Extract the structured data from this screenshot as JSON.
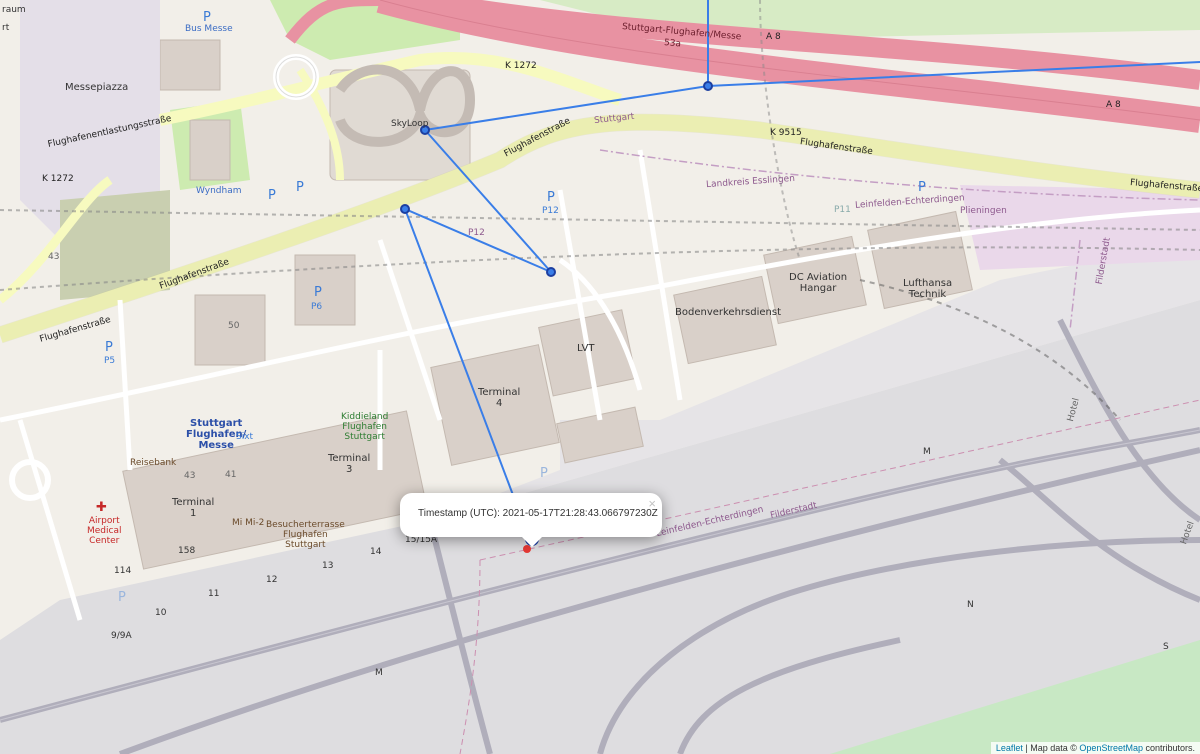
{
  "map": {
    "popup": {
      "text": "Timestamp (UTC): 2021-05-17T21:28:43.066797230Z",
      "close_label": "×"
    },
    "attribution": {
      "leaflet_link": "Leaflet",
      "separator": " | Map data © ",
      "osm_link": "OpenStreetMap",
      "suffix": " contributors."
    },
    "route_color": "#3a7ee8",
    "places": {
      "skyloop": "SkyLoop",
      "messepiazza": "Messepiazza",
      "wyndham": "Wyndham",
      "bus_messe": "Bus Messe",
      "p12": "P12",
      "p12_road": "P12",
      "p6": "P6",
      "p5": "P5",
      "p11": "P11",
      "n50": "50",
      "n43": "43",
      "n43b": "43",
      "n41": "41",
      "lvt": "LVT",
      "terminal4": "Terminal\n4",
      "terminal3": "Terminal\n3",
      "terminal1": "Terminal\n1",
      "station": "Stuttgart\nFlughafen/\nMesse",
      "sixt": "Sixt",
      "reisebank": "Reisebank",
      "kiddieland": "Kiddieland\nFlughafen\nStuttgart",
      "besucherterrasse": "Besucherterrasse\nFlughafen\nStuttgart",
      "mi_mi2": "Mi Mi-2",
      "medical": "Airport\nMedical\nCenter",
      "dc_aviation": "DC Aviation\nHangar",
      "lufthansa": "Lufthansa\nTechnik",
      "bodenverkehrsdienst": "Bodenverkehrsdienst",
      "plieningen": "Plieningen",
      "leinfelden1": "Leinfelden-Echterdingen",
      "leinfelden2": "Leinfelden-Echterdingen",
      "landkreis": "Landkreis Esslingen",
      "filderstadt": "Filderstadt",
      "filderstadt2": "Filderstadt",
      "stuttgart_admin": "Stuttgart",
      "hotel1": "Hotel",
      "hotel2": "Hotel",
      "n158": "158",
      "n14": "14",
      "n15": "15/15A",
      "n13": "13",
      "n12": "12",
      "n11": "11",
      "n10": "10",
      "n114": "114",
      "n9": "9/9A",
      "m1": "M",
      "m2": "M",
      "n_taxi": "N",
      "s_taxi": "S",
      "raum": "raum",
      "rt": "rt"
    },
    "roads": {
      "flughafenstrasse1": "Flughafenstraße",
      "flughafenstrasse2": "Flughafenstraße",
      "flughafenstrasse3": "Flughafenstraße",
      "flughafenstrasse4": "Flughafenstraße",
      "flughafenstrasse5": "Flughafenstraße",
      "entlastung": "Flughafenentlastungsstraße",
      "k1272a": "K 1272",
      "k1272b": "K 1272",
      "k9515": "K 9515",
      "a8a": "A 8",
      "a8b": "A 8",
      "exit": "Stuttgart-Flughafen/Messe",
      "exit_num": "53a"
    }
  }
}
